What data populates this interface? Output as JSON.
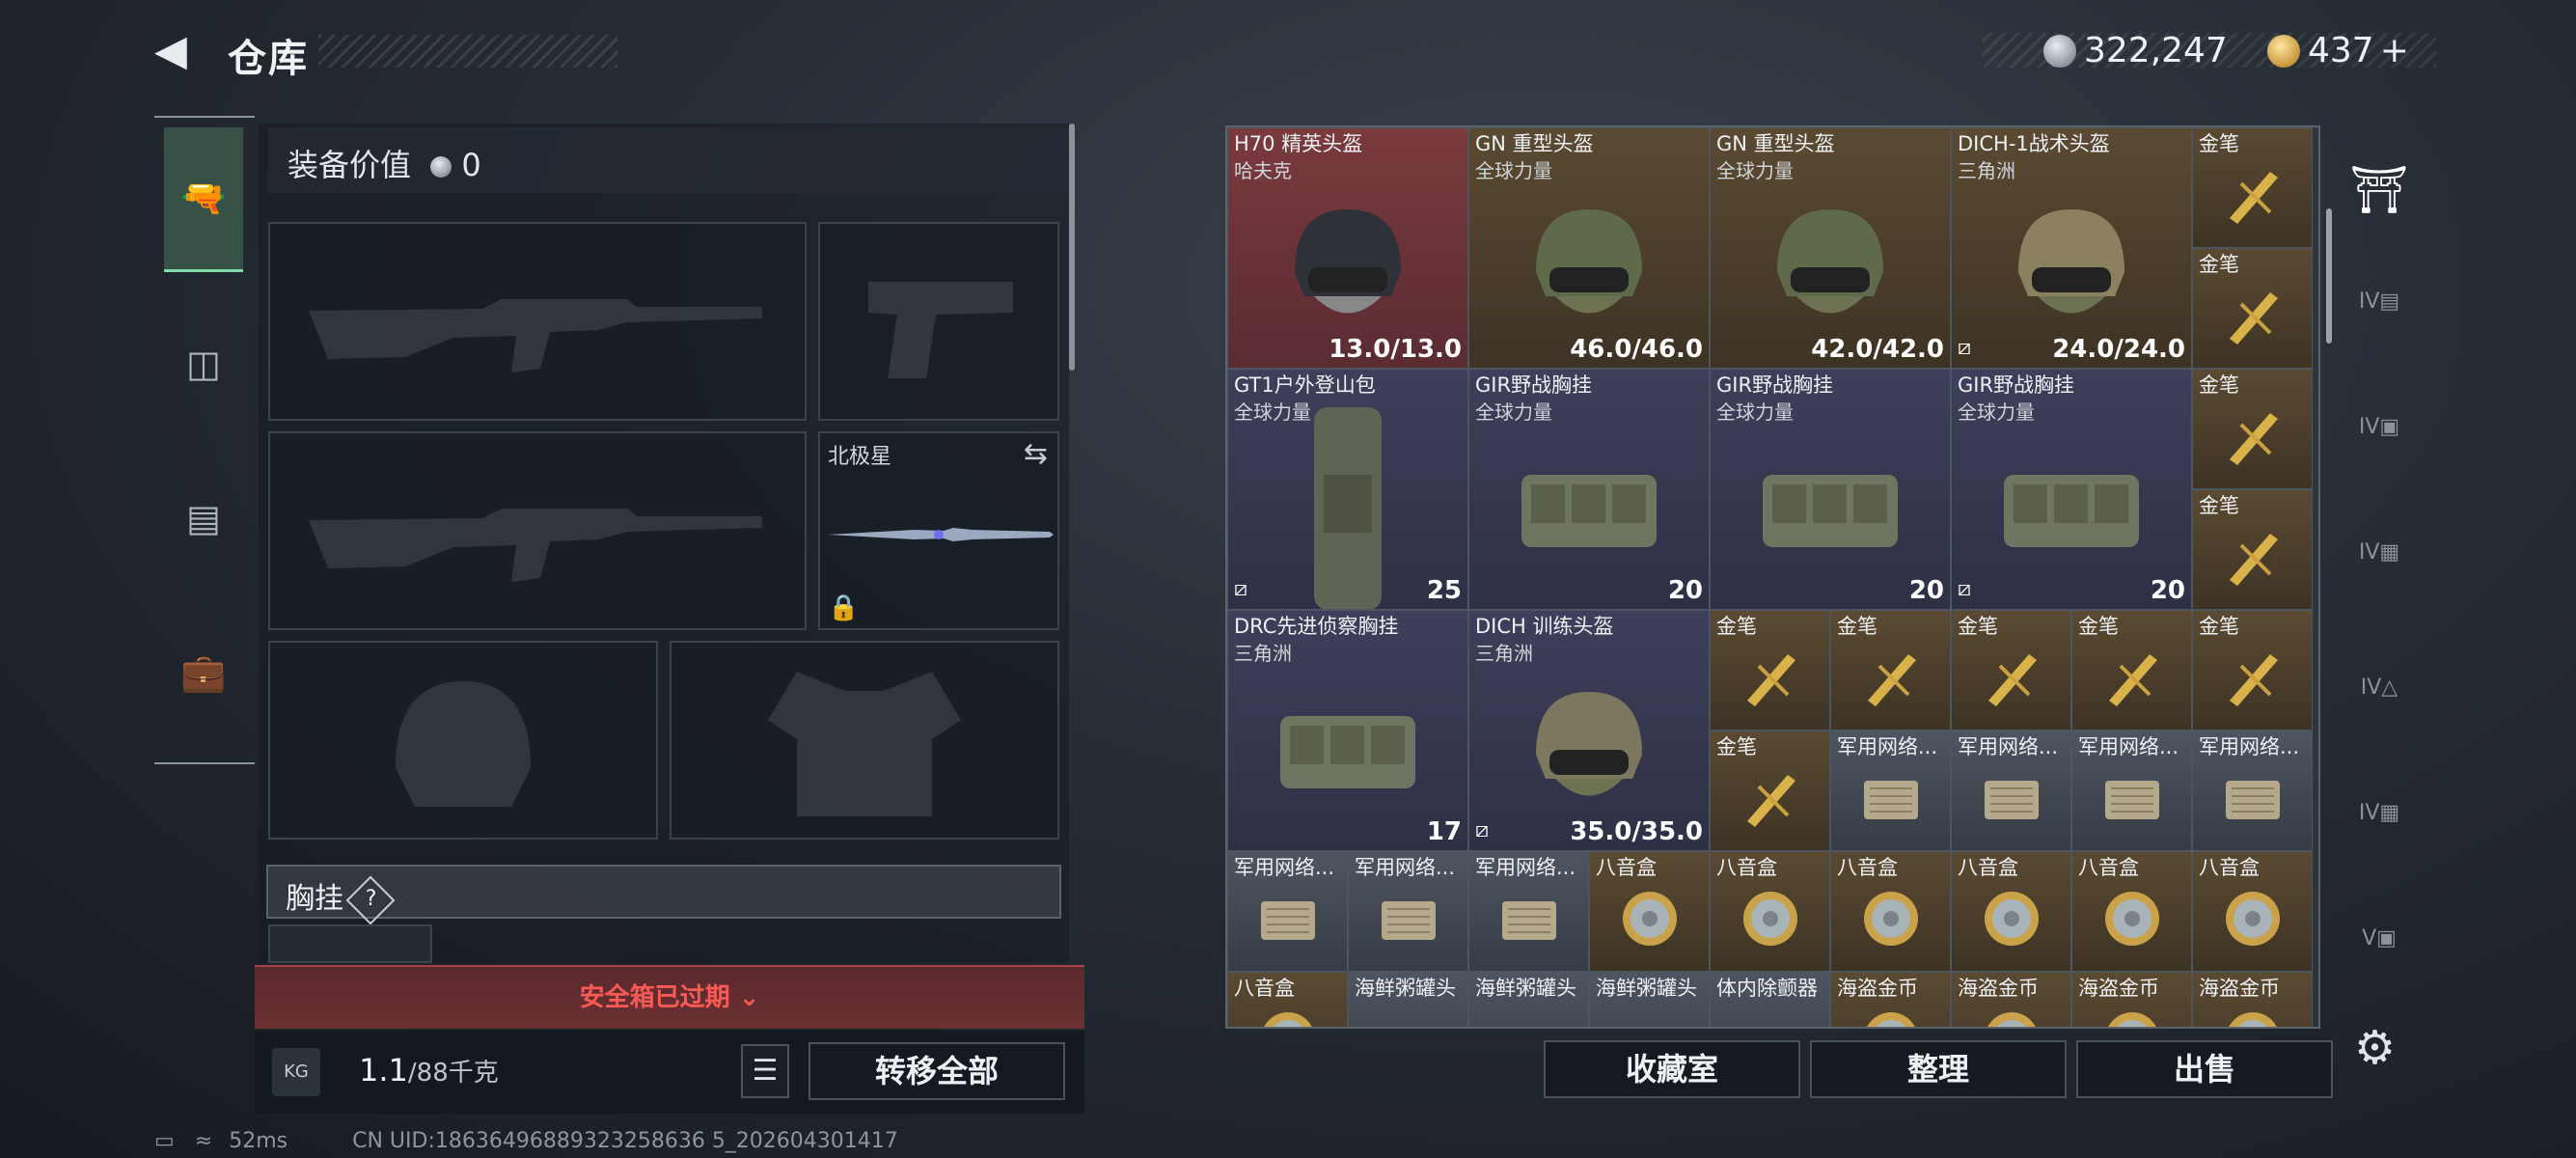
{
  "header": {
    "title": "仓库",
    "back_icon": "back-arrow-icon"
  },
  "currency": {
    "silver": "322,247",
    "gold": "437",
    "gold_add": "+"
  },
  "left_nav": [
    "gun-icon",
    "armor-icon",
    "backpack-icon",
    "toolbox-icon"
  ],
  "equipment": {
    "value_label": "装备价值",
    "value": "0",
    "slot_melee_name": "北极星",
    "chest_section": "胸挂",
    "chest_help": "?",
    "safebox_expired": "安全箱已过期",
    "weight_current": "1.1",
    "weight_max": "/88千克",
    "kg_icon": "KG",
    "transfer_all": "转移全部"
  },
  "grid": {
    "items": [
      {
        "name": "H70 精英头盔",
        "maker": "哈夫克",
        "stat": "13.0/13.0",
        "bg": "red",
        "type": "helmet-black"
      },
      {
        "name": "GN 重型头盔",
        "maker": "全球力量",
        "stat": "46.0/46.0",
        "bg": "gold",
        "type": "helmet-green"
      },
      {
        "name": "GN 重型头盔",
        "maker": "全球力量",
        "stat": "42.0/42.0",
        "bg": "gold",
        "type": "helmet-green"
      },
      {
        "name": "DICH-1战术头盔",
        "maker": "三角洲",
        "stat": "24.0/24.0",
        "bg": "gold",
        "type": "helmet-tan",
        "noins": true
      },
      {
        "name": "GT1户外登山包",
        "maker": "全球力量",
        "stat": "25",
        "bg": "purp",
        "type": "backpack",
        "noins": true
      },
      {
        "name": "GIR野战胸挂",
        "maker": "全球力量",
        "stat": "20",
        "bg": "purp",
        "type": "rig"
      },
      {
        "name": "GIR野战胸挂",
        "maker": "全球力量",
        "stat": "20",
        "bg": "purp",
        "type": "rig"
      },
      {
        "name": "GIR野战胸挂",
        "maker": "全球力量",
        "stat": "20",
        "bg": "purp",
        "type": "rig",
        "noins": true
      },
      {
        "name": "DRC先进侦察胸挂",
        "maker": "三角洲",
        "stat": "17",
        "bg": "purp",
        "type": "rig"
      },
      {
        "name": "DICH 训练头盔",
        "maker": "三角洲",
        "stat": "35.0/35.0",
        "bg": "purp",
        "type": "helmet-camo",
        "noins": true
      }
    ],
    "pen_label": "金笔",
    "net_label": "军用网络...",
    "music_label": "八音盒",
    "seafood_label": "海鲜粥罐头",
    "pacemaker_label": "体内除颤器",
    "pirate_label": "海盗金币"
  },
  "right_nav": [
    "vault-icon",
    "case-iv-1",
    "case-iv-2",
    "case-iv-3",
    "case-iv-4",
    "case-iv-5",
    "case-v"
  ],
  "bottom": {
    "collection": "收藏室",
    "arrange": "整理",
    "sell": "出售"
  },
  "status": {
    "ping": "52ms",
    "uid": "CN UID:18636496889323258636 5_202604301417"
  }
}
